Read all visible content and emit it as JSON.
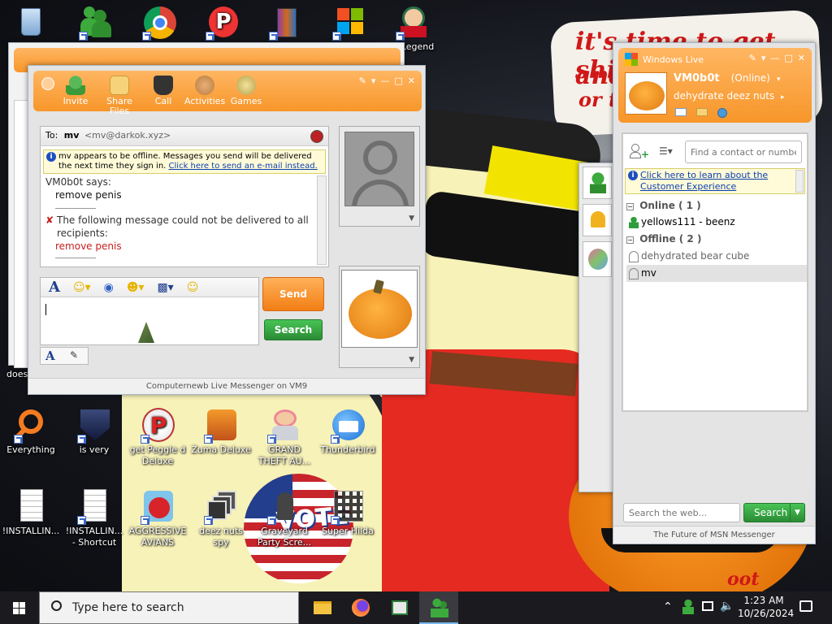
{
  "wallpaper": {
    "scrawl_line1": "it's time to get shit",
    "scrawl_line2": "and",
    "scrawl_line3": "or t",
    "flag_text": "VOTE",
    "corner_text": "oot"
  },
  "desktop": {
    "icons": [
      {
        "label": "",
        "icon": "recycle-bin-icon"
      },
      {
        "label": "",
        "icon": "msn-messenger-icon"
      },
      {
        "label": "",
        "icon": "chrome-icon"
      },
      {
        "label": "",
        "icon": "peggle-icon"
      },
      {
        "label": "",
        "icon": "winrar-icon"
      },
      {
        "label": "",
        "icon": "windows-logo-icon"
      },
      {
        "label": "Legend",
        "icon": "legend-game-icon"
      },
      {
        "label": "Everything",
        "icon": "everything-search-icon"
      },
      {
        "label": "is very",
        "icon": "rl-shield-icon"
      },
      {
        "label": "get Peggle d Deluxe",
        "icon": "peggle-icon"
      },
      {
        "label": "Zuma Deluxe",
        "icon": "zuma-icon"
      },
      {
        "label": "GRAND THEFT AU...",
        "icon": "gta-icon"
      },
      {
        "label": "Thunderbird",
        "icon": "thunderbird-icon"
      },
      {
        "label": "!INSTALLIN...",
        "icon": "text-file-icon"
      },
      {
        "label": "!INSTALLIN... - Shortcut",
        "icon": "text-file-icon"
      },
      {
        "label": "AGGRESSIVE AVIANS",
        "icon": "angry-bird-icon"
      },
      {
        "label": "deez nuts spy",
        "icon": "windows-stack-icon"
      },
      {
        "label": "Graveyard Party Scre...",
        "icon": "graveyard-icon"
      },
      {
        "label": "Super Hilda",
        "icon": "super-hilda-icon"
      },
      {
        "label": "does",
        "icon": ""
      }
    ]
  },
  "chat_window": {
    "toolbar": [
      "Invite",
      "Share Files",
      "Call",
      "Activities",
      "Games"
    ],
    "to_label": "To:",
    "to_name": "mv",
    "to_email": "<mv@darkok.xyz>",
    "offline_notice": "mv appears to be offline. Messages you send will be delivered the next time they sign in.",
    "offline_link": "Click here to send an e-mail instead.",
    "sender_says": "VM0b0t says:",
    "message_1": "remove penis",
    "error_text": "The following message could not be delivered to all recipients:",
    "message_2": "remove penis",
    "send_button": "Send",
    "search_button": "Search",
    "footer": "Computernewb Live Messenger on VM9"
  },
  "contact_window": {
    "title": "Windows Live",
    "username": "VM0b0t",
    "status": "(Online)",
    "personal_message": "dehydrate deez nuts",
    "search_placeholder": "Find a contact or number...",
    "promo_link": "Click here to learn about the Customer Experience",
    "groups": [
      {
        "name": "Online ( 1 )",
        "contacts": [
          {
            "name": "yellows111 - beenz",
            "online": true
          }
        ]
      },
      {
        "name": "Offline ( 2 )",
        "contacts": [
          {
            "name": "dehydrated bear cube",
            "online": false
          },
          {
            "name": "mv",
            "online": false
          }
        ]
      }
    ],
    "web_search_placeholder": "Search the web...",
    "web_search_button": "Search",
    "footer": "The Future of MSN Messenger"
  },
  "taskbar": {
    "search_placeholder": "Type here to search",
    "time": "1:23 AM",
    "date": "10/26/2024"
  },
  "colors": {
    "msn_orange": "#f7962a",
    "send_orange": "#f59a30",
    "search_green": "#2f9d3c",
    "link_blue": "#0b3fb0",
    "error_red": "#c81e1e"
  }
}
